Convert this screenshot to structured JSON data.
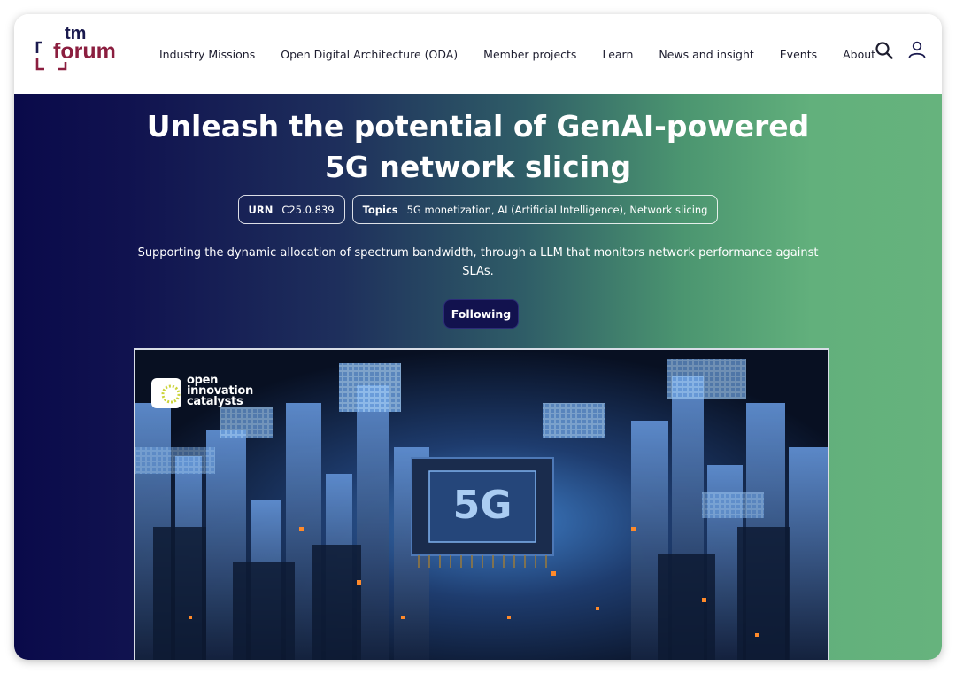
{
  "logo": {
    "line1": "tm",
    "line2": "forum",
    "color_primary": "#8b1e3f",
    "color_secondary": "#1a1a4e"
  },
  "nav": {
    "items": [
      {
        "label": "Industry Missions"
      },
      {
        "label": "Open Digital Architecture (ODA)"
      },
      {
        "label": "Member projects"
      },
      {
        "label": "Learn"
      },
      {
        "label": "News and insight"
      },
      {
        "label": "Events"
      },
      {
        "label": "About"
      }
    ],
    "search_icon": "search-icon",
    "user_icon": "user-icon"
  },
  "hero": {
    "title_line1": "Unleash the potential of GenAI-powered",
    "title_line2": "5G network slicing",
    "urn_label": "URN",
    "urn_value": "C25.0.839",
    "topics_label": "Topics",
    "topics_value": "5G monetization, AI (Artificial Intelligence), Network slicing",
    "description": "Supporting the dynamic allocation of spectrum bandwidth, through a LLM that monitors network performance against SLAs.",
    "follow_label": "Following",
    "gradient_start": "#0a0a4a",
    "gradient_end": "#66b37d"
  },
  "image": {
    "badge_line1": "open",
    "badge_line2": "innovation",
    "badge_line3": "catalysts",
    "chip_text": "5G"
  }
}
